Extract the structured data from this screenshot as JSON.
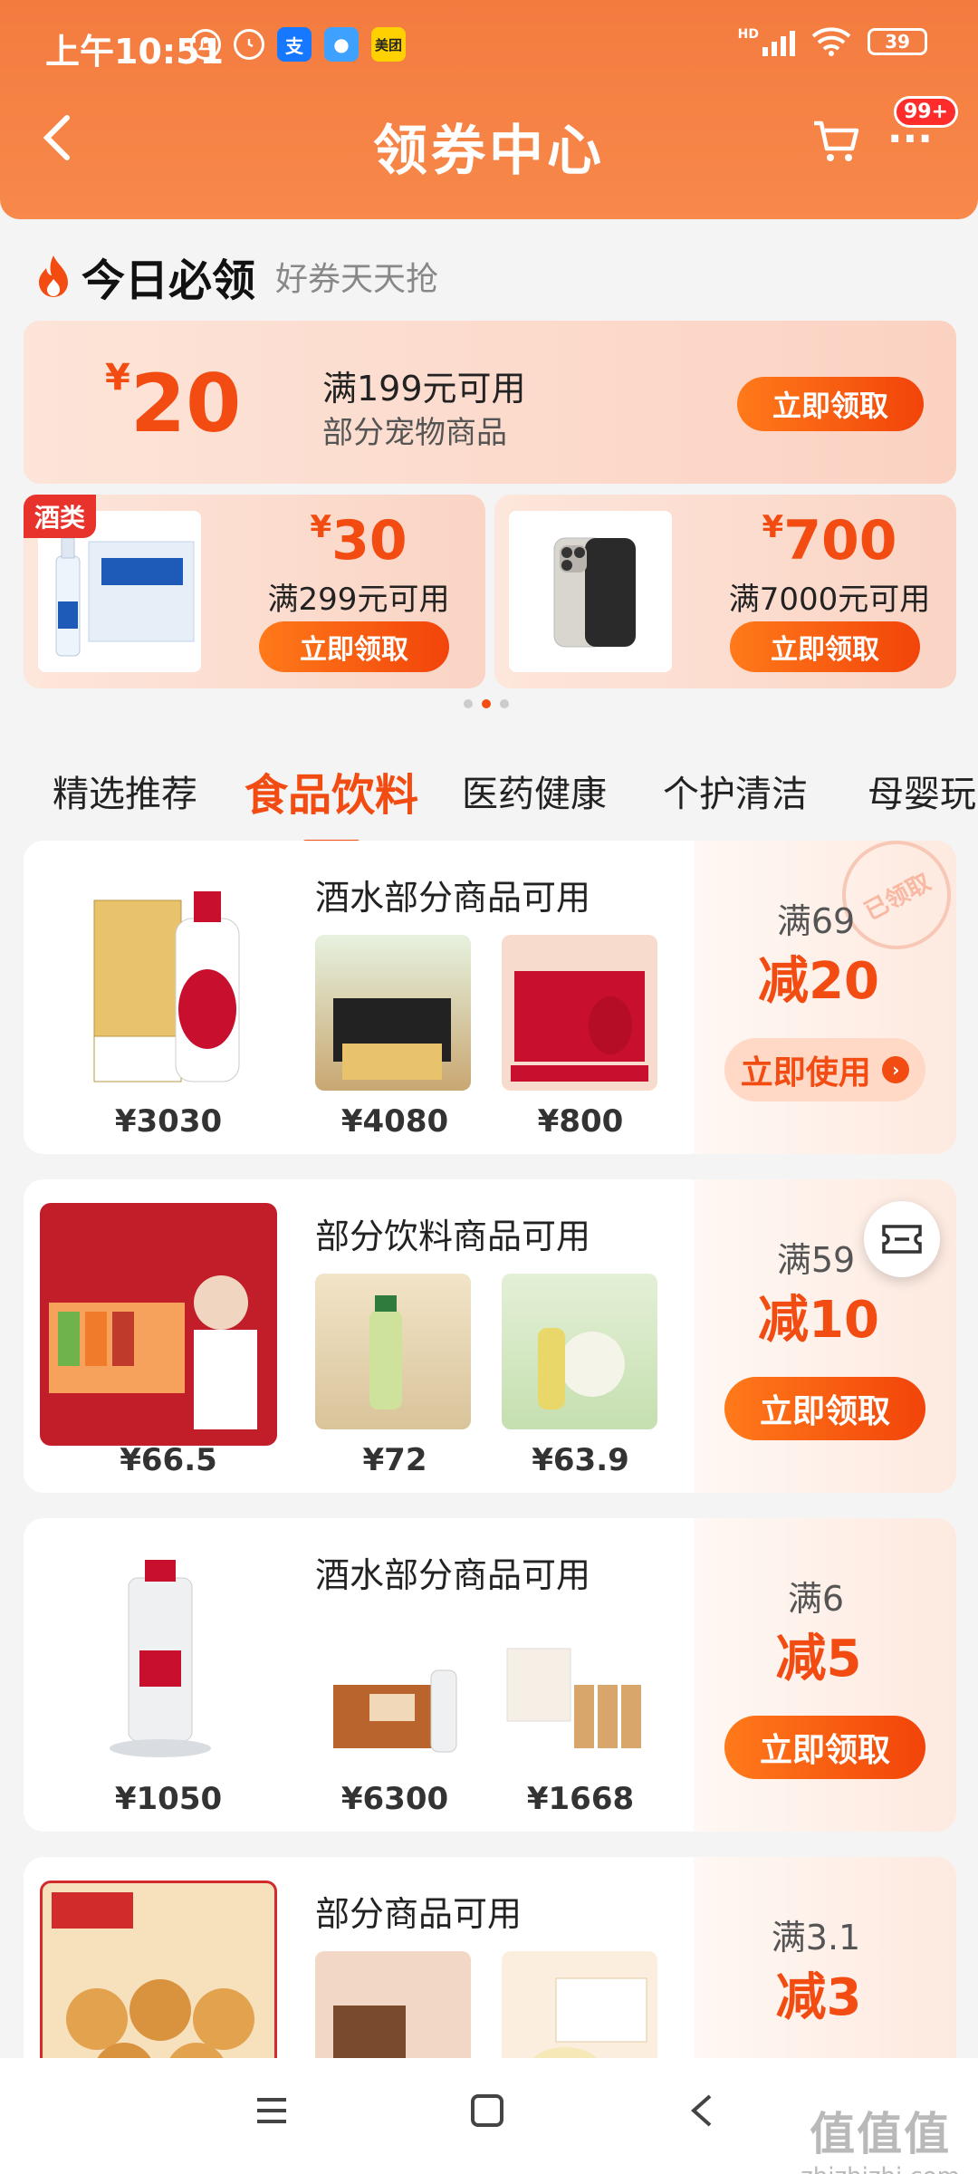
{
  "status_bar": {
    "time": "上午10:51",
    "battery": "39",
    "network_label": "HD",
    "app_icons": [
      "alipay-icon",
      "blue-app-icon",
      "meituan-icon"
    ],
    "meituan_label": "美团",
    "alipay_label": "支"
  },
  "nav": {
    "title": "领券中心",
    "badge": "99+"
  },
  "today": {
    "title": "今日必领",
    "subtitle": "好券天天抢"
  },
  "big_coupon": {
    "currency": "¥",
    "amount": "20",
    "condition": "满199元可用",
    "scope": "部分宠物商品",
    "button": "立即领取"
  },
  "small_coupons": [
    {
      "tag": "酒类",
      "currency": "¥",
      "amount": "30",
      "condition": "满299元可用",
      "button": "立即领取"
    },
    {
      "tag": "",
      "currency": "¥",
      "amount": "700",
      "condition": "满7000元可用",
      "button": "立即领取"
    }
  ],
  "tabs": [
    {
      "label": "精选推荐"
    },
    {
      "label": "食品饮料",
      "active": true
    },
    {
      "label": "医药健康"
    },
    {
      "label": "个护清洁"
    },
    {
      "label": "母婴玩"
    }
  ],
  "cards": [
    {
      "heading": "酒水部分商品可用",
      "main_price": "¥3030",
      "thumb_prices": [
        "¥4080",
        "¥800"
      ],
      "condition": "满69",
      "discount": "减20",
      "button": "立即使用",
      "stamp": "已领取"
    },
    {
      "heading": "部分饮料商品可用",
      "main_price": "¥66.5",
      "thumb_prices": [
        "¥72",
        "¥63.9"
      ],
      "condition": "满59",
      "discount": "减10",
      "button": "立即领取"
    },
    {
      "heading": "酒水部分商品可用",
      "main_price": "¥1050",
      "thumb_prices": [
        "¥6300",
        "¥1668"
      ],
      "condition": "满6",
      "discount": "减5",
      "button": "立即领取"
    },
    {
      "heading": "部分商品可用",
      "main_price": "",
      "thumb_prices": [
        "",
        ""
      ],
      "condition": "满3.1",
      "discount": "减3",
      "button": ""
    }
  ],
  "watermark": {
    "main": "值值值",
    "sub": "zhizhizhi.com"
  },
  "colors": {
    "primary": "#f24c12",
    "header": "#f47b3f"
  }
}
